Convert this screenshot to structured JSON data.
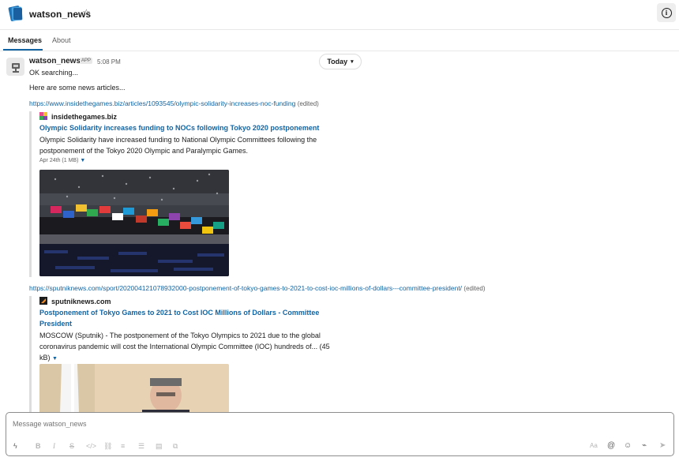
{
  "header": {
    "title": "watson_news",
    "star_icon": "☆",
    "info_icon": "i"
  },
  "tabs": [
    {
      "label": "Messages",
      "active": true
    },
    {
      "label": "About",
      "active": false
    }
  ],
  "date_divider": {
    "label": "Today",
    "chevron": "⌄"
  },
  "message": {
    "sender": "watson_news",
    "badge": "APP",
    "time": "5:08 PM",
    "lines": [
      "OK searching...",
      "Here are some news articles..."
    ]
  },
  "links": [
    {
      "url": "https://www.insidethegames.biz/articles/1093545/olympic-solidarity-increases-noc-funding",
      "edited": "(edited)",
      "source": "insidethegames.biz",
      "title": "Olympic Solidarity increases funding to NOCs following Tokyo 2020 postponement",
      "desc": "Olympic Solidarity have increased funding to National Olympic Committees following the postponement of the Tokyo 2020 Olympic and Paralympic Games.",
      "meta": "Apr 24th (1 MB)",
      "image_alt": "Stadium crowd with many national flags"
    },
    {
      "url": "https://sputniknews.com/sport/202004121078932000-postponement-of-tokyo-games-to-2021-to-cost-ioc-millions-of-dollars---committee-president/",
      "edited": "(edited)",
      "source": "sputniknews.com",
      "title": "Postponement of Tokyo Games to 2021 to Cost IOC Millions of Dollars - Committee President",
      "desc": "MOSCOW (Sputnik) - The postponement of the Tokyo Olympics to 2021 due to the global coronavirus pandemic will cost the International Olympic Committee (IOC) hundreds of...",
      "meta": "(45 kB)",
      "image_alt": "IOC president speaking"
    }
  ],
  "composer": {
    "placeholder": "Message watson_news",
    "format_icons": [
      "bolt-icon",
      "bold-icon",
      "italic-icon",
      "strike-icon",
      "code-icon",
      "link-icon",
      "numbered-list-icon",
      "bullet-list-icon",
      "blockquote-icon",
      "code-block-icon"
    ],
    "right_icons": [
      "text-format-icon",
      "mention-icon",
      "emoji-icon",
      "attach-icon",
      "send-icon"
    ],
    "aa_label": "Aa"
  },
  "colors": {
    "link": "#1264a3",
    "text": "#1d1c1d",
    "muted": "#616061",
    "border": "#e8e8e8"
  }
}
